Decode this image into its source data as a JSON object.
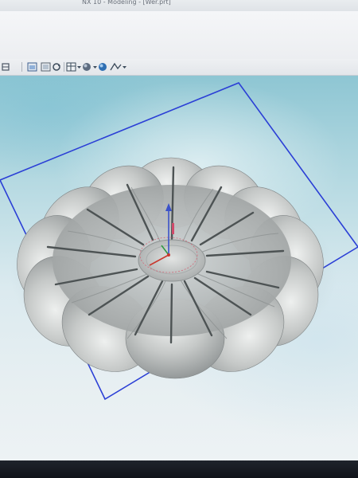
{
  "window": {
    "title": "NX 10 - Modeling - [Wer.prt]"
  },
  "toolbar": {
    "items": [
      {
        "name": "layer-visibility-icon"
      },
      {
        "name": "reset-orientation-icon"
      },
      {
        "name": "fit-view-icon"
      },
      {
        "name": "refresh-icon"
      },
      {
        "name": "view-orientation-icon"
      },
      {
        "name": "render-style-icon"
      },
      {
        "name": "lighting-icon"
      },
      {
        "name": "edit-section-icon"
      }
    ]
  },
  "viewport": {
    "model": "flower-shaped dish with slotted petals",
    "background_top": "#8ec6d3",
    "background_bottom": "#edf2f4",
    "model_color": "#b9bcbc",
    "datum_plane_color": "#2b3fd6"
  }
}
